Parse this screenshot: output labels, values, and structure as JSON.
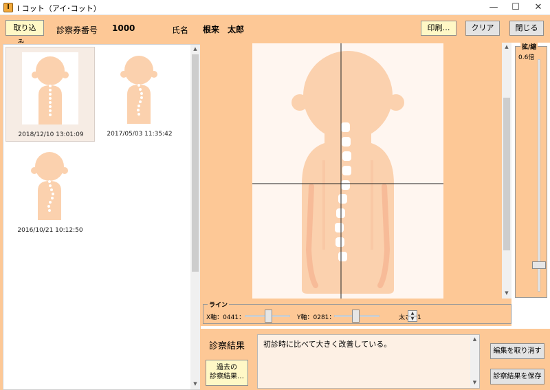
{
  "window": {
    "title": "I コット（アイ･コット）",
    "app_icon_letter": "I",
    "min_glyph": "—",
    "max_glyph": "☐",
    "close_glyph": "✕"
  },
  "header": {
    "import_label": "取り込み…",
    "ticket_label": "診察券番号",
    "ticket_value": "1000",
    "name_label": "氏名",
    "name_value": "根来　太郎",
    "print_label": "印刷…",
    "clear_label": "クリア",
    "close_label": "閉じる"
  },
  "thumbnails": [
    {
      "date": "2018/12/10 13:01:09",
      "selected": true
    },
    {
      "date": "2017/05/03 11:35:42",
      "selected": false
    },
    {
      "date": "2016/10/21 10:12:50",
      "selected": false
    }
  ],
  "zoom": {
    "legend": "拡/縮",
    "value": "0.6倍"
  },
  "line": {
    "legend": "ライン",
    "x_label": "X軸：0441：",
    "y_label": "Y軸：0281：",
    "thickness_label": "太さ：1"
  },
  "result": {
    "label": "診察結果",
    "text": "初診時に比べて大きく改善している。",
    "history_label_1": "過去の",
    "history_label_2": "診察結果…",
    "undo_label": "編集を取り消す",
    "save_label": "診察結果を保存"
  },
  "colors": {
    "panel": "#fdc896",
    "skin": "#fbd1ae",
    "vertebra": "#ffffff"
  }
}
